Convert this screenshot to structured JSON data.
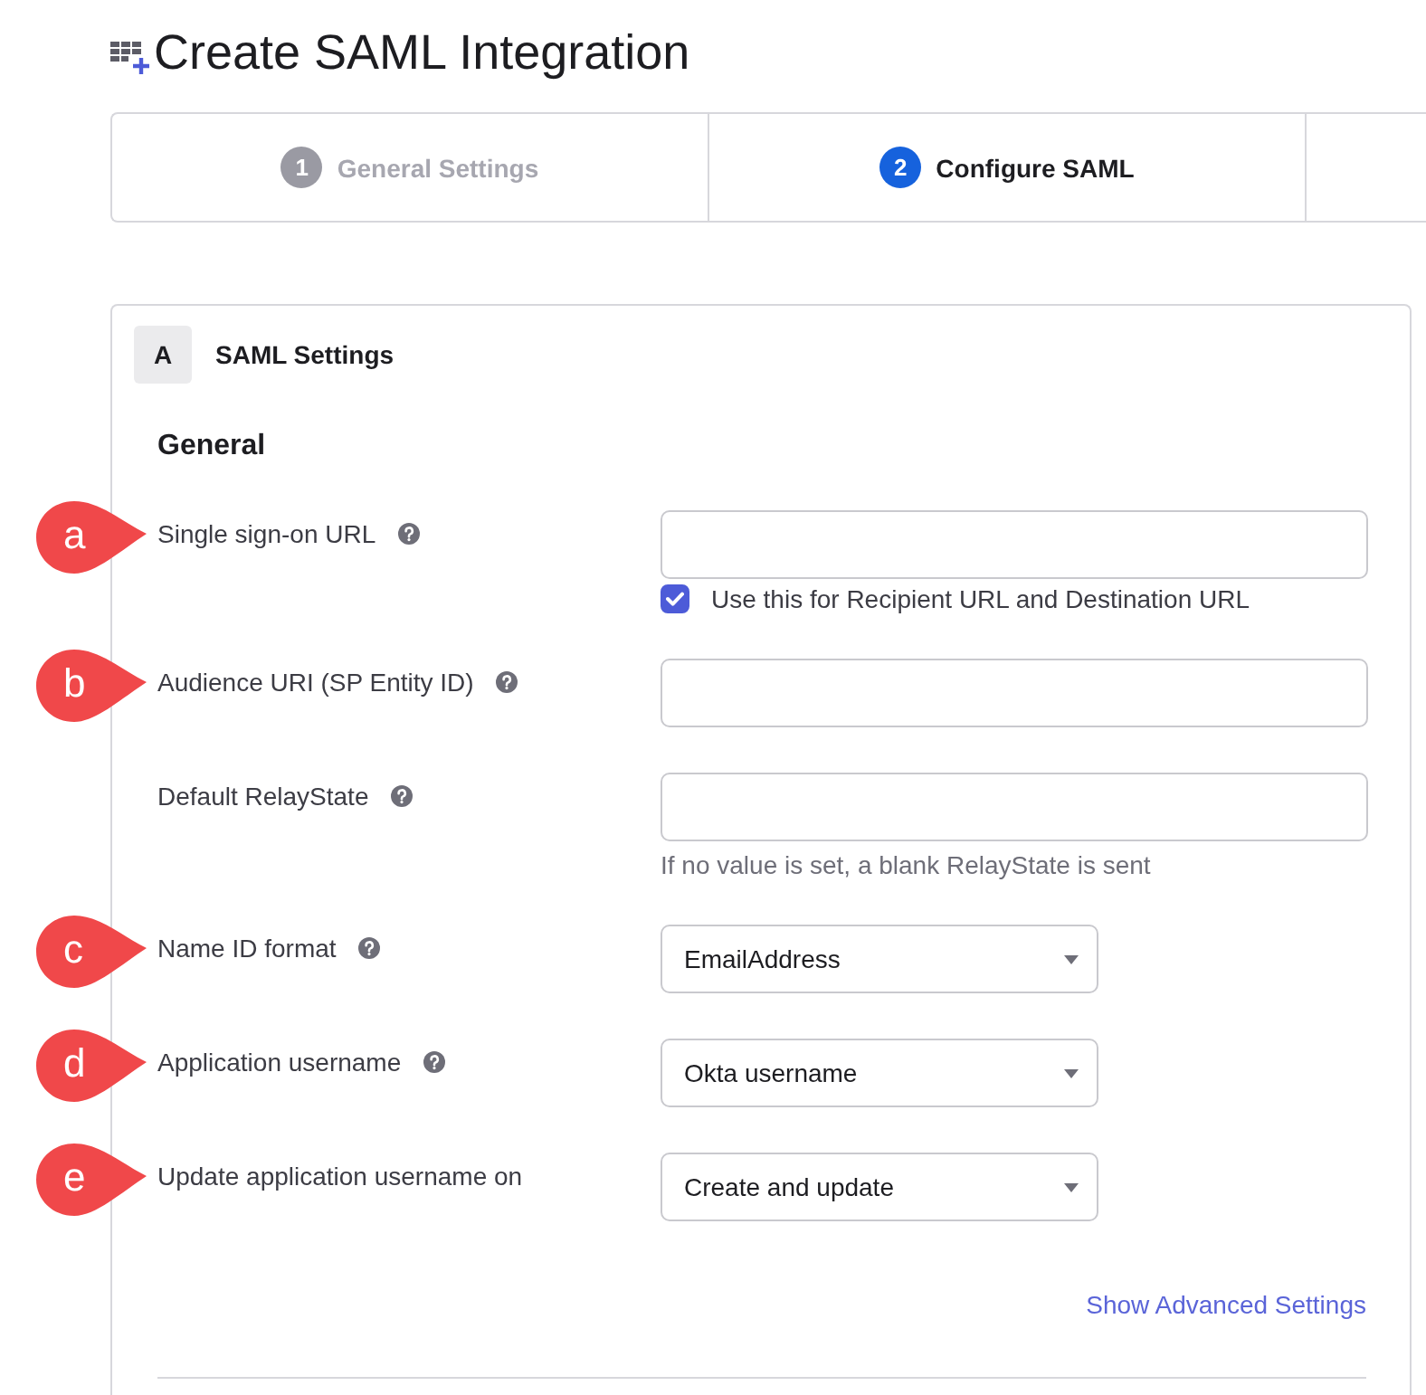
{
  "page": {
    "title": "Create SAML Integration"
  },
  "steps": [
    {
      "number": "1",
      "label": "General Settings",
      "selected": false
    },
    {
      "number": "2",
      "label": "Configure SAML",
      "selected": true
    }
  ],
  "section": {
    "letter": "A",
    "title": "SAML Settings",
    "group": "General"
  },
  "fields": [
    {
      "callout": "a",
      "label": "Single sign-on URL",
      "help": true,
      "kind": "text",
      "checkbox": {
        "label": "Use this for Recipient URL and Destination URL",
        "checked": true
      }
    },
    {
      "callout": "b",
      "label": "Audience URI (SP Entity ID)",
      "help": true,
      "kind": "text"
    },
    {
      "label": "Default RelayState",
      "help": true,
      "kind": "text",
      "hint": "If no value is set, a blank RelayState is sent"
    },
    {
      "callout": "c",
      "label": "Name ID format",
      "help": true,
      "kind": "select",
      "value": "EmailAddress"
    },
    {
      "callout": "d",
      "label": "Application username",
      "help": true,
      "kind": "select",
      "value": "Okta username"
    },
    {
      "callout": "e",
      "label": "Update application username on",
      "help": false,
      "kind": "select",
      "value": "Create and update"
    }
  ],
  "advanced_link": "Show Advanced Settings"
}
